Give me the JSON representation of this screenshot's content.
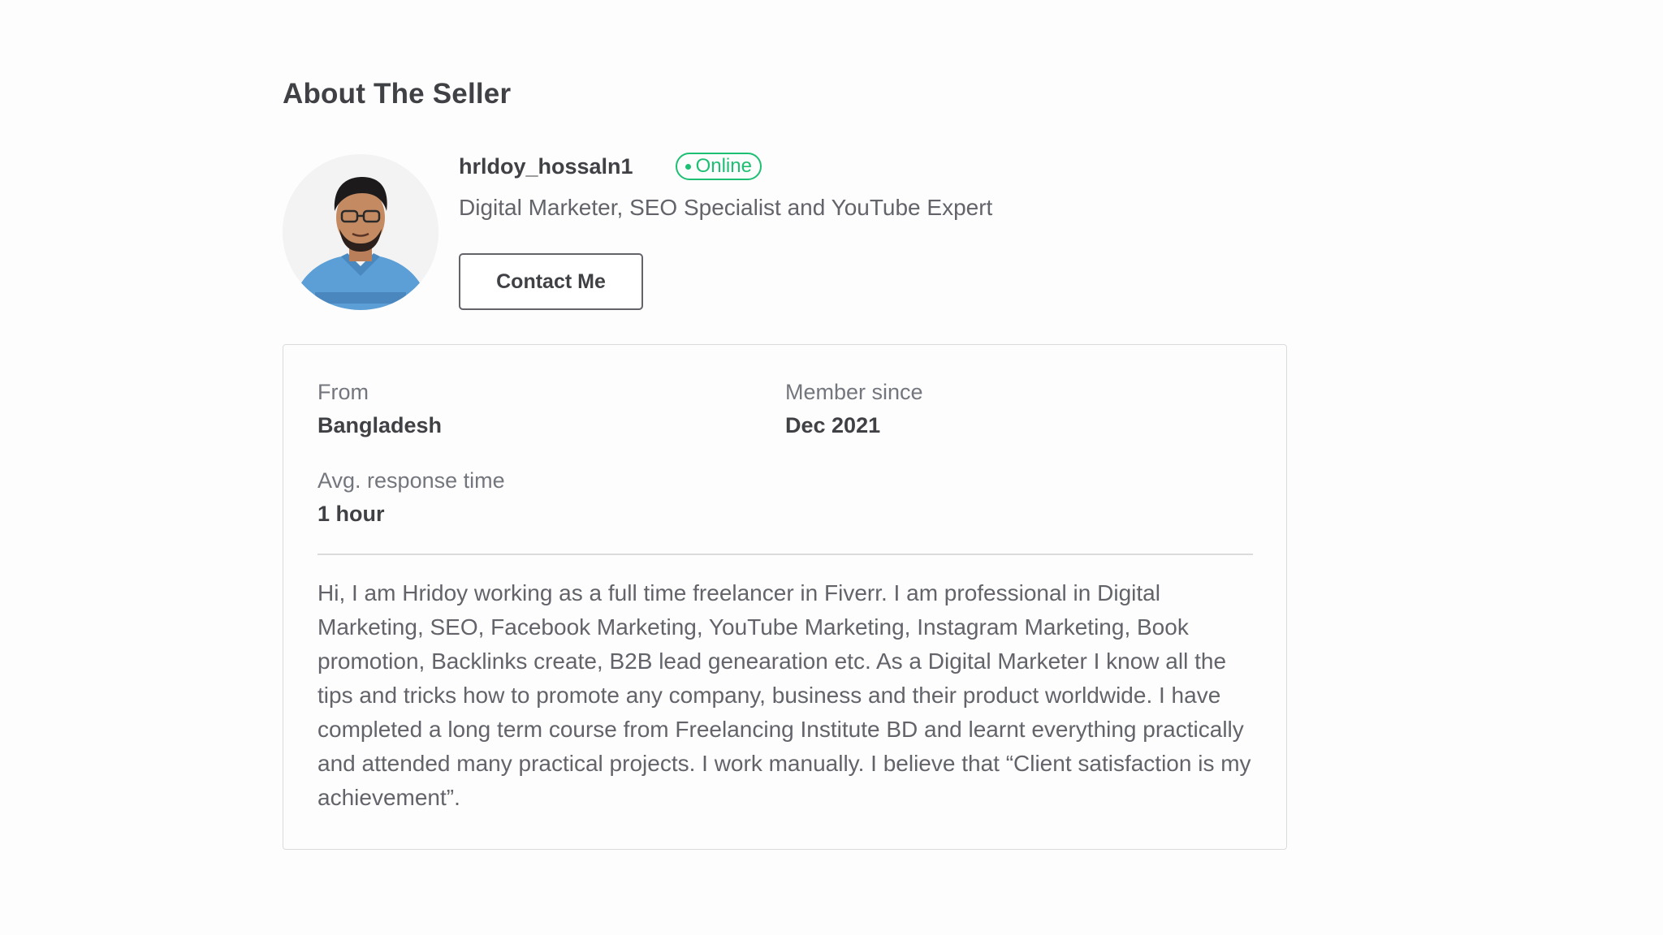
{
  "section": {
    "title": "About The Seller"
  },
  "seller": {
    "username": "hrldoy_hossaln1",
    "status": "Online",
    "tagline": "Digital Marketer, SEO Specialist and YouTube Expert",
    "contact_label": "Contact Me"
  },
  "stats": {
    "from_label": "From",
    "from_value": "Bangladesh",
    "member_label": "Member since",
    "member_value": "Dec 2021",
    "response_label": "Avg. response time",
    "response_value": "1 hour"
  },
  "bio": "Hi, I am Hridoy working as a full time freelancer in Fiverr. I am professional in Digital Marketing, SEO, Facebook Marketing, YouTube Marketing, Instagram Marketing, Book promotion, Backlinks create, B2B lead genearation etc. As a Digital Marketer I know all the tips and tricks how to promote any company, business and their product worldwide. I have completed a long term course from Freelancing Institute BD and learnt everything practically and attended many practical projects. I work manually. I believe that “Client satisfaction is my achievement”.",
  "colors": {
    "online": "#1dbf73",
    "text_dark": "#404145",
    "text_muted": "#62646a",
    "border": "#dadbdd"
  },
  "icons": {
    "avatar": "seller-profile-photo",
    "status_dot": "online-dot-icon"
  }
}
